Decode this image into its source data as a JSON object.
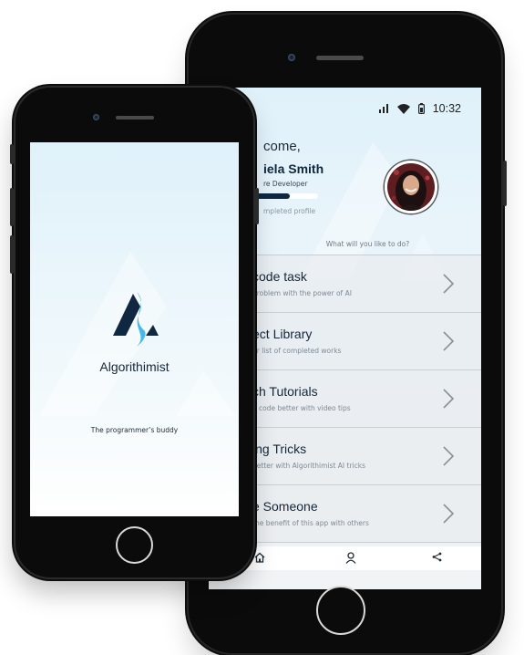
{
  "home_screen": {
    "status_bar": {
      "time": "10:32",
      "icons": [
        "signal-icon",
        "wifi-icon",
        "battery-icon"
      ]
    },
    "greeting": "come,",
    "user_name": "iela Smith",
    "user_role": "re Developer",
    "profile_progress": 0.55,
    "profile_progress_text": "mpleted profile",
    "prompt": "What will you like to do?",
    "menu_items": [
      {
        "title": "code task",
        "subtitle": "problem with the power of AI",
        "icon": "chevron-right-icon"
      },
      {
        "title": "ect Library",
        "subtitle": "ur list of completed works",
        "icon": "chevron-right-icon"
      },
      {
        "title": "ch Tutorials",
        "subtitle": "o code better with video tips",
        "icon": "chevron-right-icon"
      },
      {
        "title": "ing Tricks",
        "subtitle": "better with Algorithimist AI tricks",
        "icon": "chevron-right-icon"
      },
      {
        "title": "e Someone",
        "subtitle": "the benefit of this app with others",
        "icon": "chevron-right-icon"
      }
    ],
    "bottom_nav": [
      "home-icon",
      "profile-icon",
      "share-icon"
    ]
  },
  "splash_screen": {
    "app_name": "Algorithimist",
    "tagline": "The programmer’s buddy"
  },
  "colors": {
    "navy": "#0f2740",
    "accent_blue": "#48b8e8",
    "screen_bg": "#dff1fa",
    "phone_body": "#0b0b0b"
  }
}
